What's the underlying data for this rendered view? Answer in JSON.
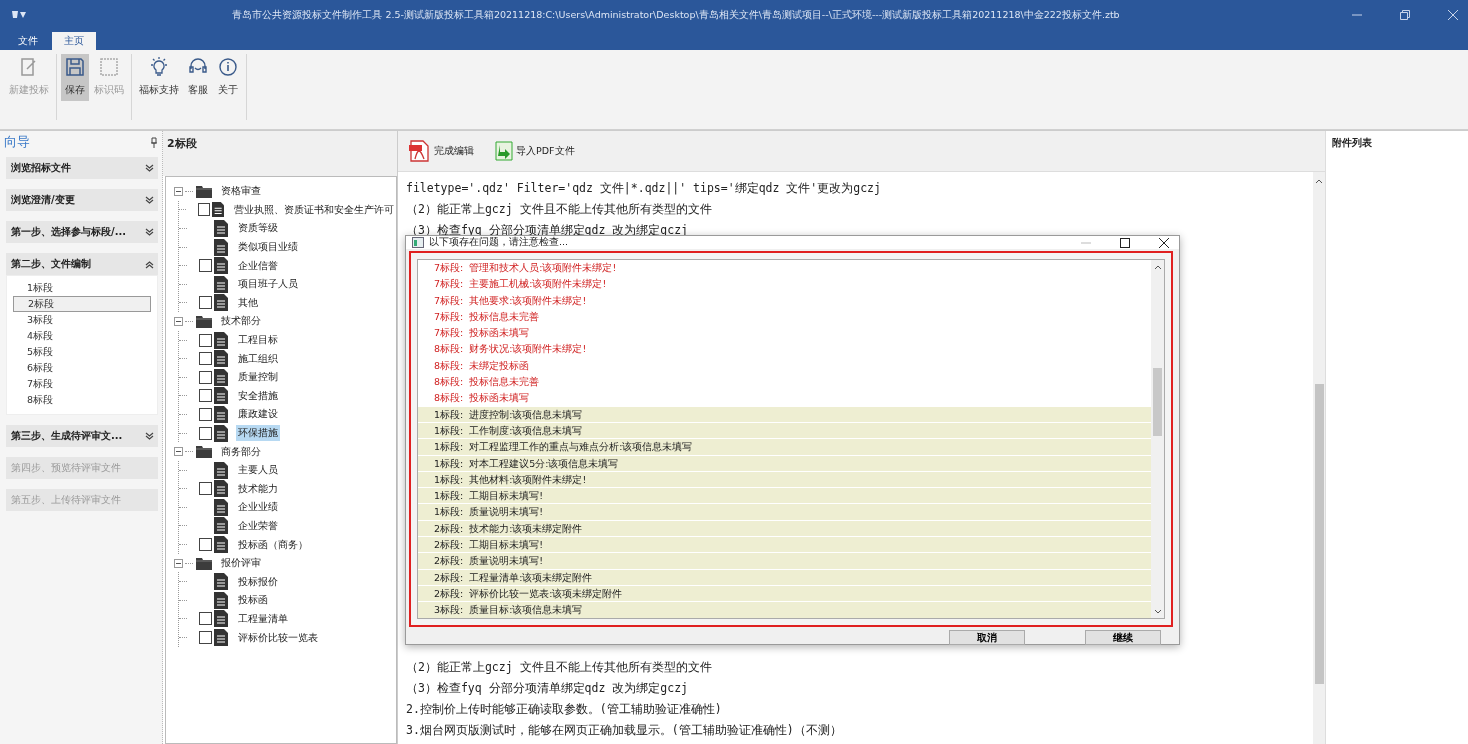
{
  "window": {
    "title": "青岛市公共资源投标文件制作工具 2.5-测试新版投标工具箱20211218:C:\\Users\\Administrator\\Desktop\\青岛相关文件\\青岛测试项目--\\正式环境---测试新版投标工具箱20211218\\中金222投标文件.ztb"
  },
  "ribbon_tabs": [
    {
      "label": "文件",
      "selected": false
    },
    {
      "label": "主页",
      "selected": true
    }
  ],
  "ribbon_buttons": [
    {
      "label": "新建投标",
      "kind": "new",
      "disabled": true,
      "pressed": false
    },
    {
      "label": "保存",
      "kind": "save",
      "disabled": false,
      "pressed": true
    },
    {
      "label": "标识码",
      "kind": "code",
      "disabled": true,
      "pressed": false
    },
    {
      "label": "福标支持",
      "kind": "bulb",
      "disabled": false,
      "pressed": false
    },
    {
      "label": "客服",
      "kind": "support",
      "disabled": false,
      "pressed": false
    },
    {
      "label": "关于",
      "kind": "info",
      "disabled": false,
      "pressed": false
    }
  ],
  "navigator": {
    "title": "向导",
    "sections": [
      {
        "title": "浏览招标文件",
        "expanded": false,
        "disabled": false
      },
      {
        "title": "浏览澄清/变更",
        "expanded": false,
        "disabled": false
      },
      {
        "title": "第一步、选择参与标段/...",
        "expanded": false,
        "disabled": false
      },
      {
        "title": "第二步、文件编制",
        "expanded": true,
        "disabled": false,
        "items": [
          {
            "label": "1标段",
            "selected": false
          },
          {
            "label": "2标段",
            "selected": true
          },
          {
            "label": "3标段",
            "selected": false
          },
          {
            "label": "4标段",
            "selected": false
          },
          {
            "label": "5标段",
            "selected": false
          },
          {
            "label": "6标段",
            "selected": false
          },
          {
            "label": "7标段",
            "selected": false
          },
          {
            "label": "8标段",
            "selected": false
          }
        ]
      },
      {
        "title": "第三步、生成待评审文...",
        "expanded": false,
        "disabled": false
      },
      {
        "title": "第四步、预览待评审文件",
        "expanded": false,
        "disabled": true
      },
      {
        "title": "第五步、上传待评审文件",
        "expanded": false,
        "disabled": true
      }
    ]
  },
  "tree_panel": {
    "title": "2标段",
    "groups": [
      {
        "label": "资格审查",
        "expanded": true,
        "children": [
          {
            "label": "营业执照、资质证书和安全生产许可",
            "kind": "checkbox",
            "checked": false,
            "selected": false
          },
          {
            "label": "资质等级",
            "kind": "plain",
            "selected": false
          },
          {
            "label": "类似项目业绩",
            "kind": "plain",
            "selected": false
          },
          {
            "label": "企业信誉",
            "kind": "checkbox",
            "checked": false,
            "selected": false
          },
          {
            "label": "项目班子人员",
            "kind": "plain",
            "selected": false
          },
          {
            "label": "其他",
            "kind": "checkbox",
            "checked": false,
            "selected": false
          }
        ]
      },
      {
        "label": "技术部分",
        "expanded": true,
        "children": [
          {
            "label": "工程目标",
            "kind": "checkbox",
            "checked": false,
            "selected": false
          },
          {
            "label": "施工组织",
            "kind": "checkbox",
            "checked": false,
            "selected": false
          },
          {
            "label": "质量控制",
            "kind": "checkbox",
            "checked": false,
            "selected": false
          },
          {
            "label": "安全措施",
            "kind": "checkbox",
            "checked": false,
            "selected": false
          },
          {
            "label": "廉政建设",
            "kind": "checkbox",
            "checked": false,
            "selected": false
          },
          {
            "label": "环保措施",
            "kind": "checkbox",
            "checked": false,
            "selected": true
          }
        ]
      },
      {
        "label": "商务部分",
        "expanded": true,
        "children": [
          {
            "label": "主要人员",
            "kind": "plain",
            "selected": false
          },
          {
            "label": "技术能力",
            "kind": "checkbox",
            "checked": false,
            "selected": false
          },
          {
            "label": "企业业绩",
            "kind": "plain",
            "selected": false
          },
          {
            "label": "企业荣誉",
            "kind": "plain",
            "selected": false
          },
          {
            "label": "投标函（商务）",
            "kind": "checkbox",
            "checked": false,
            "selected": false
          }
        ]
      },
      {
        "label": "报价评审",
        "expanded": true,
        "children": [
          {
            "label": "投标报价",
            "kind": "plain",
            "selected": false
          },
          {
            "label": "投标函",
            "kind": "plain",
            "selected": false
          },
          {
            "label": "工程量清单",
            "kind": "checkbox",
            "checked": false,
            "selected": false
          },
          {
            "label": "评标价比较一览表",
            "kind": "checkbox",
            "checked": false,
            "selected": false
          }
        ]
      }
    ]
  },
  "editor": {
    "toolbar": [
      {
        "label": "完成编辑",
        "kind": "pdf"
      },
      {
        "label": "导入PDF文件",
        "kind": "import"
      }
    ],
    "lines_top": [
      "filetype='.qdz' Filter='qdz 文件|*.qdz||' tips='绑定qdz 文件'更改为gczj",
      "（2）能正常上gczj 文件且不能上传其他所有类型的文件",
      "（3）检查fyq 分部分项清单绑定qdz 改为绑定gczj"
    ],
    "lines_bottom": [
      "（2）能正常上gczj 文件且不能上传其他所有类型的文件",
      "（3）检查fyq 分部分项清单绑定qdz 改为绑定gczj",
      "2.控制价上传时能够正确读取参数。(管工辅助验证准确性)",
      "3.烟台网页版测试时，能够在网页正确加载显示。(管工辅助验证准确性)（不测）"
    ]
  },
  "attachments": {
    "title": "附件列表"
  },
  "dialog": {
    "title": "以下项存在问题，请注意检查...",
    "rows": [
      {
        "section": "7标段:",
        "message": "管理和技术人员:该项附件未绑定!",
        "kind": "error"
      },
      {
        "section": "7标段:",
        "message": "主要施工机械:该项附件未绑定!",
        "kind": "error"
      },
      {
        "section": "7标段:",
        "message": "其他要求:该项附件未绑定!",
        "kind": "error"
      },
      {
        "section": "7标段:",
        "message": "投标信息未完善",
        "kind": "error"
      },
      {
        "section": "7标段:",
        "message": "投标函未填写",
        "kind": "error"
      },
      {
        "section": "8标段:",
        "message": "财务状况:该项附件未绑定!",
        "kind": "error"
      },
      {
        "section": "8标段:",
        "message": "未绑定投标函",
        "kind": "error"
      },
      {
        "section": "8标段:",
        "message": "投标信息未完善",
        "kind": "error"
      },
      {
        "section": "8标段:",
        "message": "投标函未填写",
        "kind": "error"
      },
      {
        "section": "1标段:",
        "message": "进度控制:该项信息未填写",
        "kind": "warning"
      },
      {
        "section": "1标段:",
        "message": "工作制度:该项信息未填写",
        "kind": "warning"
      },
      {
        "section": "1标段:",
        "message": "对工程监理工作的重点与难点分析:该项信息未填写",
        "kind": "warning"
      },
      {
        "section": "1标段:",
        "message": "对本工程建议5分:该项信息未填写",
        "kind": "warning"
      },
      {
        "section": "1标段:",
        "message": "其他材料:该项附件未绑定!",
        "kind": "warning"
      },
      {
        "section": "1标段:",
        "message": "工期目标未填写!",
        "kind": "warning"
      },
      {
        "section": "1标段:",
        "message": "质量说明未填写!",
        "kind": "warning"
      },
      {
        "section": "2标段:",
        "message": "技术能力:该项未绑定附件",
        "kind": "warning"
      },
      {
        "section": "2标段:",
        "message": "工期目标未填写!",
        "kind": "warning"
      },
      {
        "section": "2标段:",
        "message": "质量说明未填写!",
        "kind": "warning"
      },
      {
        "section": "2标段:",
        "message": "工程量清单:该项未绑定附件",
        "kind": "warning"
      },
      {
        "section": "2标段:",
        "message": "评标价比较一览表:该项未绑定附件",
        "kind": "warning"
      },
      {
        "section": "3标段:",
        "message": "质量目标:该项信息未填写",
        "kind": "warning"
      }
    ],
    "buttons": [
      "取消",
      "继续"
    ]
  }
}
